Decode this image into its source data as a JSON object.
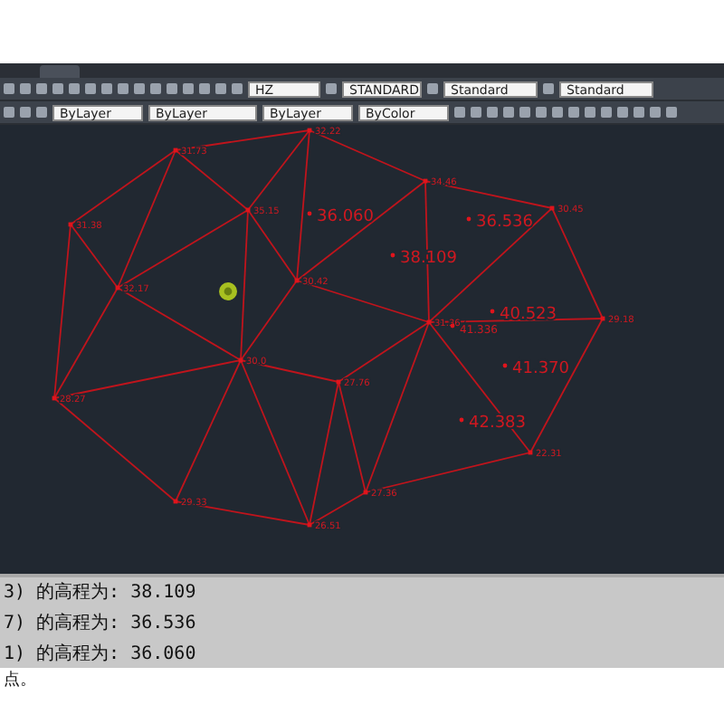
{
  "toolbar": {
    "dropdowns": [
      {
        "value": "HZ"
      },
      {
        "value": "STANDARD"
      },
      {
        "value": "Standard"
      },
      {
        "value": "Standard"
      }
    ]
  },
  "properties_bar": {
    "dropdowns": [
      {
        "value": "ByLayer"
      },
      {
        "value": "ByLayer"
      },
      {
        "value": "ByLayer"
      },
      {
        "value": "ByColor"
      }
    ]
  },
  "drawing": {
    "vertices": [
      {
        "label": "32.22"
      },
      {
        "label": "31.73"
      },
      {
        "label": "31.38"
      },
      {
        "label": "35.15"
      },
      {
        "label": "32.17"
      },
      {
        "label": "30.42"
      },
      {
        "label": "30.0"
      },
      {
        "label": "34.46"
      },
      {
        "label": "30.45"
      },
      {
        "label": "29.18"
      },
      {
        "label": "31.36"
      },
      {
        "label": "28.27"
      },
      {
        "label": "27.76"
      },
      {
        "label": "29.33"
      },
      {
        "label": "26.51"
      },
      {
        "label": "27.36"
      },
      {
        "label": "22.31"
      }
    ],
    "spot_elevations": [
      {
        "label": "36.060"
      },
      {
        "label": "38.109"
      },
      {
        "label": "36.536"
      },
      {
        "label": "40.523"
      },
      {
        "label": "41.336"
      },
      {
        "label": "41.370"
      },
      {
        "label": "42.383"
      }
    ]
  },
  "command_history": [
    "3) 的高程为: 38.109",
    "7) 的高程为: 36.536",
    "1) 的高程为: 36.060"
  ],
  "command_line": "点。"
}
